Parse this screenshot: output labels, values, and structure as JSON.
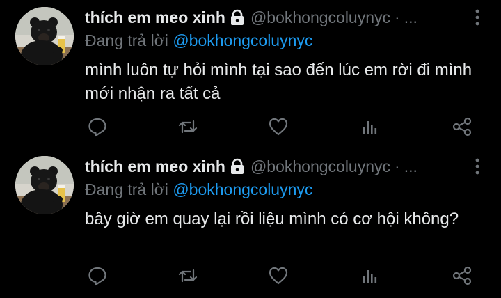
{
  "tweets": [
    {
      "author_name": "thích em meo xinh",
      "handle": "@bokhongcoluynyc",
      "separator": "·",
      "time": "...",
      "reply_prefix": "Đang trả lời",
      "reply_to": "@bokhongcoluynyc",
      "text": "mình luôn tự hỏi mình tại sao đến lúc em rời đi mình mới nhận ra tất cả",
      "icons": [
        "lock-icon",
        "more-vertical-icon",
        "reply-icon",
        "retweet-icon",
        "like-icon",
        "views-icon",
        "share-icon"
      ]
    },
    {
      "author_name": "thích em meo xinh",
      "handle": "@bokhongcoluynyc",
      "separator": "·",
      "time": "...",
      "reply_prefix": "Đang trả lời",
      "reply_to": "@bokhongcoluynyc",
      "text": "bây giờ em quay lại rồi liệu mình có cơ hội không?",
      "icons": [
        "lock-icon",
        "more-vertical-icon",
        "reply-icon",
        "retweet-icon",
        "like-icon",
        "views-icon",
        "share-icon"
      ]
    }
  ],
  "colors": {
    "background": "#000000",
    "text_primary": "#e7e9ea",
    "text_secondary": "#71767b",
    "mention": "#1d9bf0",
    "divider": "#2f3336"
  }
}
